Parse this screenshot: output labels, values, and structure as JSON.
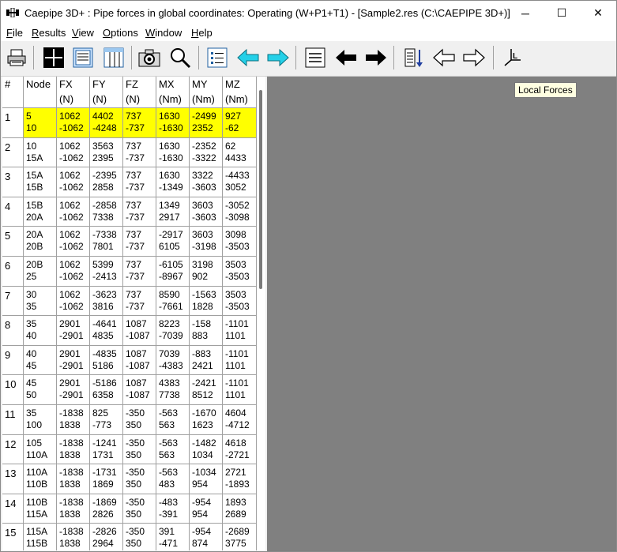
{
  "window": {
    "title": "Caepipe 3D+ : Pipe forces in global coordinates: Operating (W+P1+T1) -  [Sample2.res (C:\\CAEPIPE 3D+)]",
    "controls": {
      "minimize": "─",
      "maximize": "☐",
      "close": "✕"
    }
  },
  "menu": [
    {
      "label": "File",
      "u": "F",
      "rest": "ile"
    },
    {
      "label": "Results",
      "u": "R",
      "rest": "esults"
    },
    {
      "label": "View",
      "u": "V",
      "rest": "iew"
    },
    {
      "label": "Options",
      "u": "O",
      "rest": "ptions"
    },
    {
      "label": "Window",
      "u": "W",
      "rest": "indow"
    },
    {
      "label": "Help",
      "u": "H",
      "rest": "elp"
    }
  ],
  "toolbar": {
    "icons": [
      "printer-icon",
      "crosshair-icon",
      "text-view-icon",
      "columns-view-icon",
      "camera-icon",
      "zoom-icon",
      "list-icon",
      "arrow-left-cyan-icon",
      "arrow-right-cyan-icon",
      "lines-icon",
      "arrow-left-black-icon",
      "arrow-right-black-icon",
      "sort-down-icon",
      "arrow-left-outline-icon",
      "arrow-right-outline-icon",
      "local-axes-icon"
    ]
  },
  "tooltip": "Local Forces",
  "table": {
    "columns": [
      {
        "h1": "#",
        "h2": ""
      },
      {
        "h1": "Node",
        "h2": ""
      },
      {
        "h1": "FX",
        "h2": "(N)"
      },
      {
        "h1": "FY",
        "h2": "(N)"
      },
      {
        "h1": "FZ",
        "h2": "(N)"
      },
      {
        "h1": "MX",
        "h2": "(Nm)"
      },
      {
        "h1": "MY",
        "h2": "(Nm)"
      },
      {
        "h1": "MZ",
        "h2": "(Nm)"
      }
    ],
    "selected_row": 0,
    "rows": [
      {
        "idx": "1",
        "node": [
          "5",
          "10"
        ],
        "fx": [
          "1062",
          "-1062"
        ],
        "fy": [
          "4402",
          "-4248"
        ],
        "fz": [
          "737",
          "-737"
        ],
        "mx": [
          "1630",
          "-1630"
        ],
        "my": [
          "-2499",
          "2352"
        ],
        "mz": [
          "927",
          "-62"
        ]
      },
      {
        "idx": "2",
        "node": [
          "10",
          "15A"
        ],
        "fx": [
          "1062",
          "-1062"
        ],
        "fy": [
          "3563",
          "2395"
        ],
        "fz": [
          "737",
          "-737"
        ],
        "mx": [
          "1630",
          "-1630"
        ],
        "my": [
          "-2352",
          "-3322"
        ],
        "mz": [
          "62",
          "4433"
        ]
      },
      {
        "idx": "3",
        "node": [
          "15A",
          "15B"
        ],
        "fx": [
          "1062",
          "-1062"
        ],
        "fy": [
          "-2395",
          "2858"
        ],
        "fz": [
          "737",
          "-737"
        ],
        "mx": [
          "1630",
          "-1349"
        ],
        "my": [
          "3322",
          "-3603"
        ],
        "mz": [
          "-4433",
          "3052"
        ]
      },
      {
        "idx": "4",
        "node": [
          "15B",
          "20A"
        ],
        "fx": [
          "1062",
          "-1062"
        ],
        "fy": [
          "-2858",
          "7338"
        ],
        "fz": [
          "737",
          "-737"
        ],
        "mx": [
          "1349",
          "2917"
        ],
        "my": [
          "3603",
          "-3603"
        ],
        "mz": [
          "-3052",
          "-3098"
        ]
      },
      {
        "idx": "5",
        "node": [
          "20A",
          "20B"
        ],
        "fx": [
          "1062",
          "-1062"
        ],
        "fy": [
          "-7338",
          "7801"
        ],
        "fz": [
          "737",
          "-737"
        ],
        "mx": [
          "-2917",
          "6105"
        ],
        "my": [
          "3603",
          "-3198"
        ],
        "mz": [
          "3098",
          "-3503"
        ]
      },
      {
        "idx": "6",
        "node": [
          "20B",
          "25"
        ],
        "fx": [
          "1062",
          "-1062"
        ],
        "fy": [
          "5399",
          "-2413"
        ],
        "fz": [
          "737",
          "-737"
        ],
        "mx": [
          "-6105",
          "-8967"
        ],
        "my": [
          "3198",
          "902"
        ],
        "mz": [
          "3503",
          "-3503"
        ]
      },
      {
        "idx": "7",
        "node": [
          "30",
          "35"
        ],
        "fx": [
          "1062",
          "-1062"
        ],
        "fy": [
          "-3623",
          "3816"
        ],
        "fz": [
          "737",
          "-737"
        ],
        "mx": [
          "8590",
          "-7661"
        ],
        "my": [
          "-1563",
          "1828"
        ],
        "mz": [
          "3503",
          "-3503"
        ]
      },
      {
        "idx": "8",
        "node": [
          "35",
          "40"
        ],
        "fx": [
          "2901",
          "-2901"
        ],
        "fy": [
          "-4641",
          "4835"
        ],
        "fz": [
          "1087",
          "-1087"
        ],
        "mx": [
          "8223",
          "-7039"
        ],
        "my": [
          "-158",
          "883"
        ],
        "mz": [
          "-1101",
          "1101"
        ]
      },
      {
        "idx": "9",
        "node": [
          "40",
          "45"
        ],
        "fx": [
          "2901",
          "-2901"
        ],
        "fy": [
          "-4835",
          "5186"
        ],
        "fz": [
          "1087",
          "-1087"
        ],
        "mx": [
          "7039",
          "-4383"
        ],
        "my": [
          "-883",
          "2421"
        ],
        "mz": [
          "-1101",
          "1101"
        ]
      },
      {
        "idx": "10",
        "node": [
          "45",
          "50"
        ],
        "fx": [
          "2901",
          "-2901"
        ],
        "fy": [
          "-5186",
          "6358"
        ],
        "fz": [
          "1087",
          "-1087"
        ],
        "mx": [
          "4383",
          "7738"
        ],
        "my": [
          "-2421",
          "8512"
        ],
        "mz": [
          "-1101",
          "1101"
        ]
      },
      {
        "idx": "11",
        "node": [
          "35",
          "100"
        ],
        "fx": [
          "-1838",
          "1838"
        ],
        "fy": [
          "825",
          "-773"
        ],
        "fz": [
          "-350",
          "350"
        ],
        "mx": [
          "-563",
          "563"
        ],
        "my": [
          "-1670",
          "1623"
        ],
        "mz": [
          "4604",
          "-4712"
        ]
      },
      {
        "idx": "12",
        "node": [
          "105",
          "110A"
        ],
        "fx": [
          "-1838",
          "1838"
        ],
        "fy": [
          "-1241",
          "1731"
        ],
        "fz": [
          "-350",
          "350"
        ],
        "mx": [
          "-563",
          "563"
        ],
        "my": [
          "-1482",
          "1034"
        ],
        "mz": [
          "4618",
          "-2721"
        ]
      },
      {
        "idx": "13",
        "node": [
          "110A",
          "110B"
        ],
        "fx": [
          "-1838",
          "1838"
        ],
        "fy": [
          "-1731",
          "1869"
        ],
        "fz": [
          "-350",
          "350"
        ],
        "mx": [
          "-563",
          "483"
        ],
        "my": [
          "-1034",
          "954"
        ],
        "mz": [
          "2721",
          "-1893"
        ]
      },
      {
        "idx": "14",
        "node": [
          "110B",
          "115A"
        ],
        "fx": [
          "-1838",
          "1838"
        ],
        "fy": [
          "-1869",
          "2826"
        ],
        "fz": [
          "-350",
          "350"
        ],
        "mx": [
          "-483",
          "-391"
        ],
        "my": [
          "-954",
          "954"
        ],
        "mz": [
          "1893",
          "2689"
        ]
      },
      {
        "idx": "15",
        "node": [
          "115A",
          "115B"
        ],
        "fx": [
          "-1838",
          "1838"
        ],
        "fy": [
          "-2826",
          "2964"
        ],
        "fz": [
          "-350",
          "350"
        ],
        "mx": [
          "391",
          "-471"
        ],
        "my": [
          "-954",
          "874"
        ],
        "mz": [
          "-2689",
          "3775"
        ]
      }
    ]
  }
}
